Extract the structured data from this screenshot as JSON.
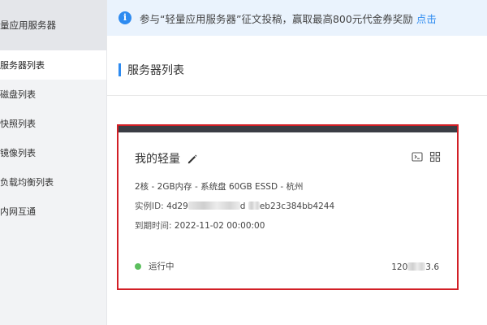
{
  "sidebar": {
    "title": "量应用服务器",
    "items": [
      {
        "label": "服务器列表",
        "active": true
      },
      {
        "label": "磁盘列表",
        "active": false
      },
      {
        "label": "快照列表",
        "active": false
      },
      {
        "label": "镜像列表",
        "active": false
      },
      {
        "label": "负载均衡列表",
        "active": false
      },
      {
        "label": "内网互通",
        "active": false
      }
    ]
  },
  "banner": {
    "icon": "info-icon",
    "text": "参与“轻量应用服务器”征文投稿，赢取最高800元代金券奖励",
    "link": "点击"
  },
  "page": {
    "title": "服务器列表"
  },
  "card": {
    "name": "我的轻量",
    "spec": "2核 - 2GB内存 - 系统盘 60GB ESSD - 杭州",
    "instance_label": "实例ID:",
    "instance_prefix": "4d29",
    "instance_mid": "d",
    "instance_suffix": "eb23c384bb4244",
    "expire_label": "到期时间:",
    "expire_value": "2022-11-02 00:00:00",
    "status": "运行中",
    "status_color": "#5cbf5e",
    "ip_prefix": "120",
    "ip_suffix": "3.6",
    "border_color": "#d21f26"
  },
  "colors": {
    "accent": "#2e8bf0",
    "banner_bg": "#eaf3fd"
  }
}
